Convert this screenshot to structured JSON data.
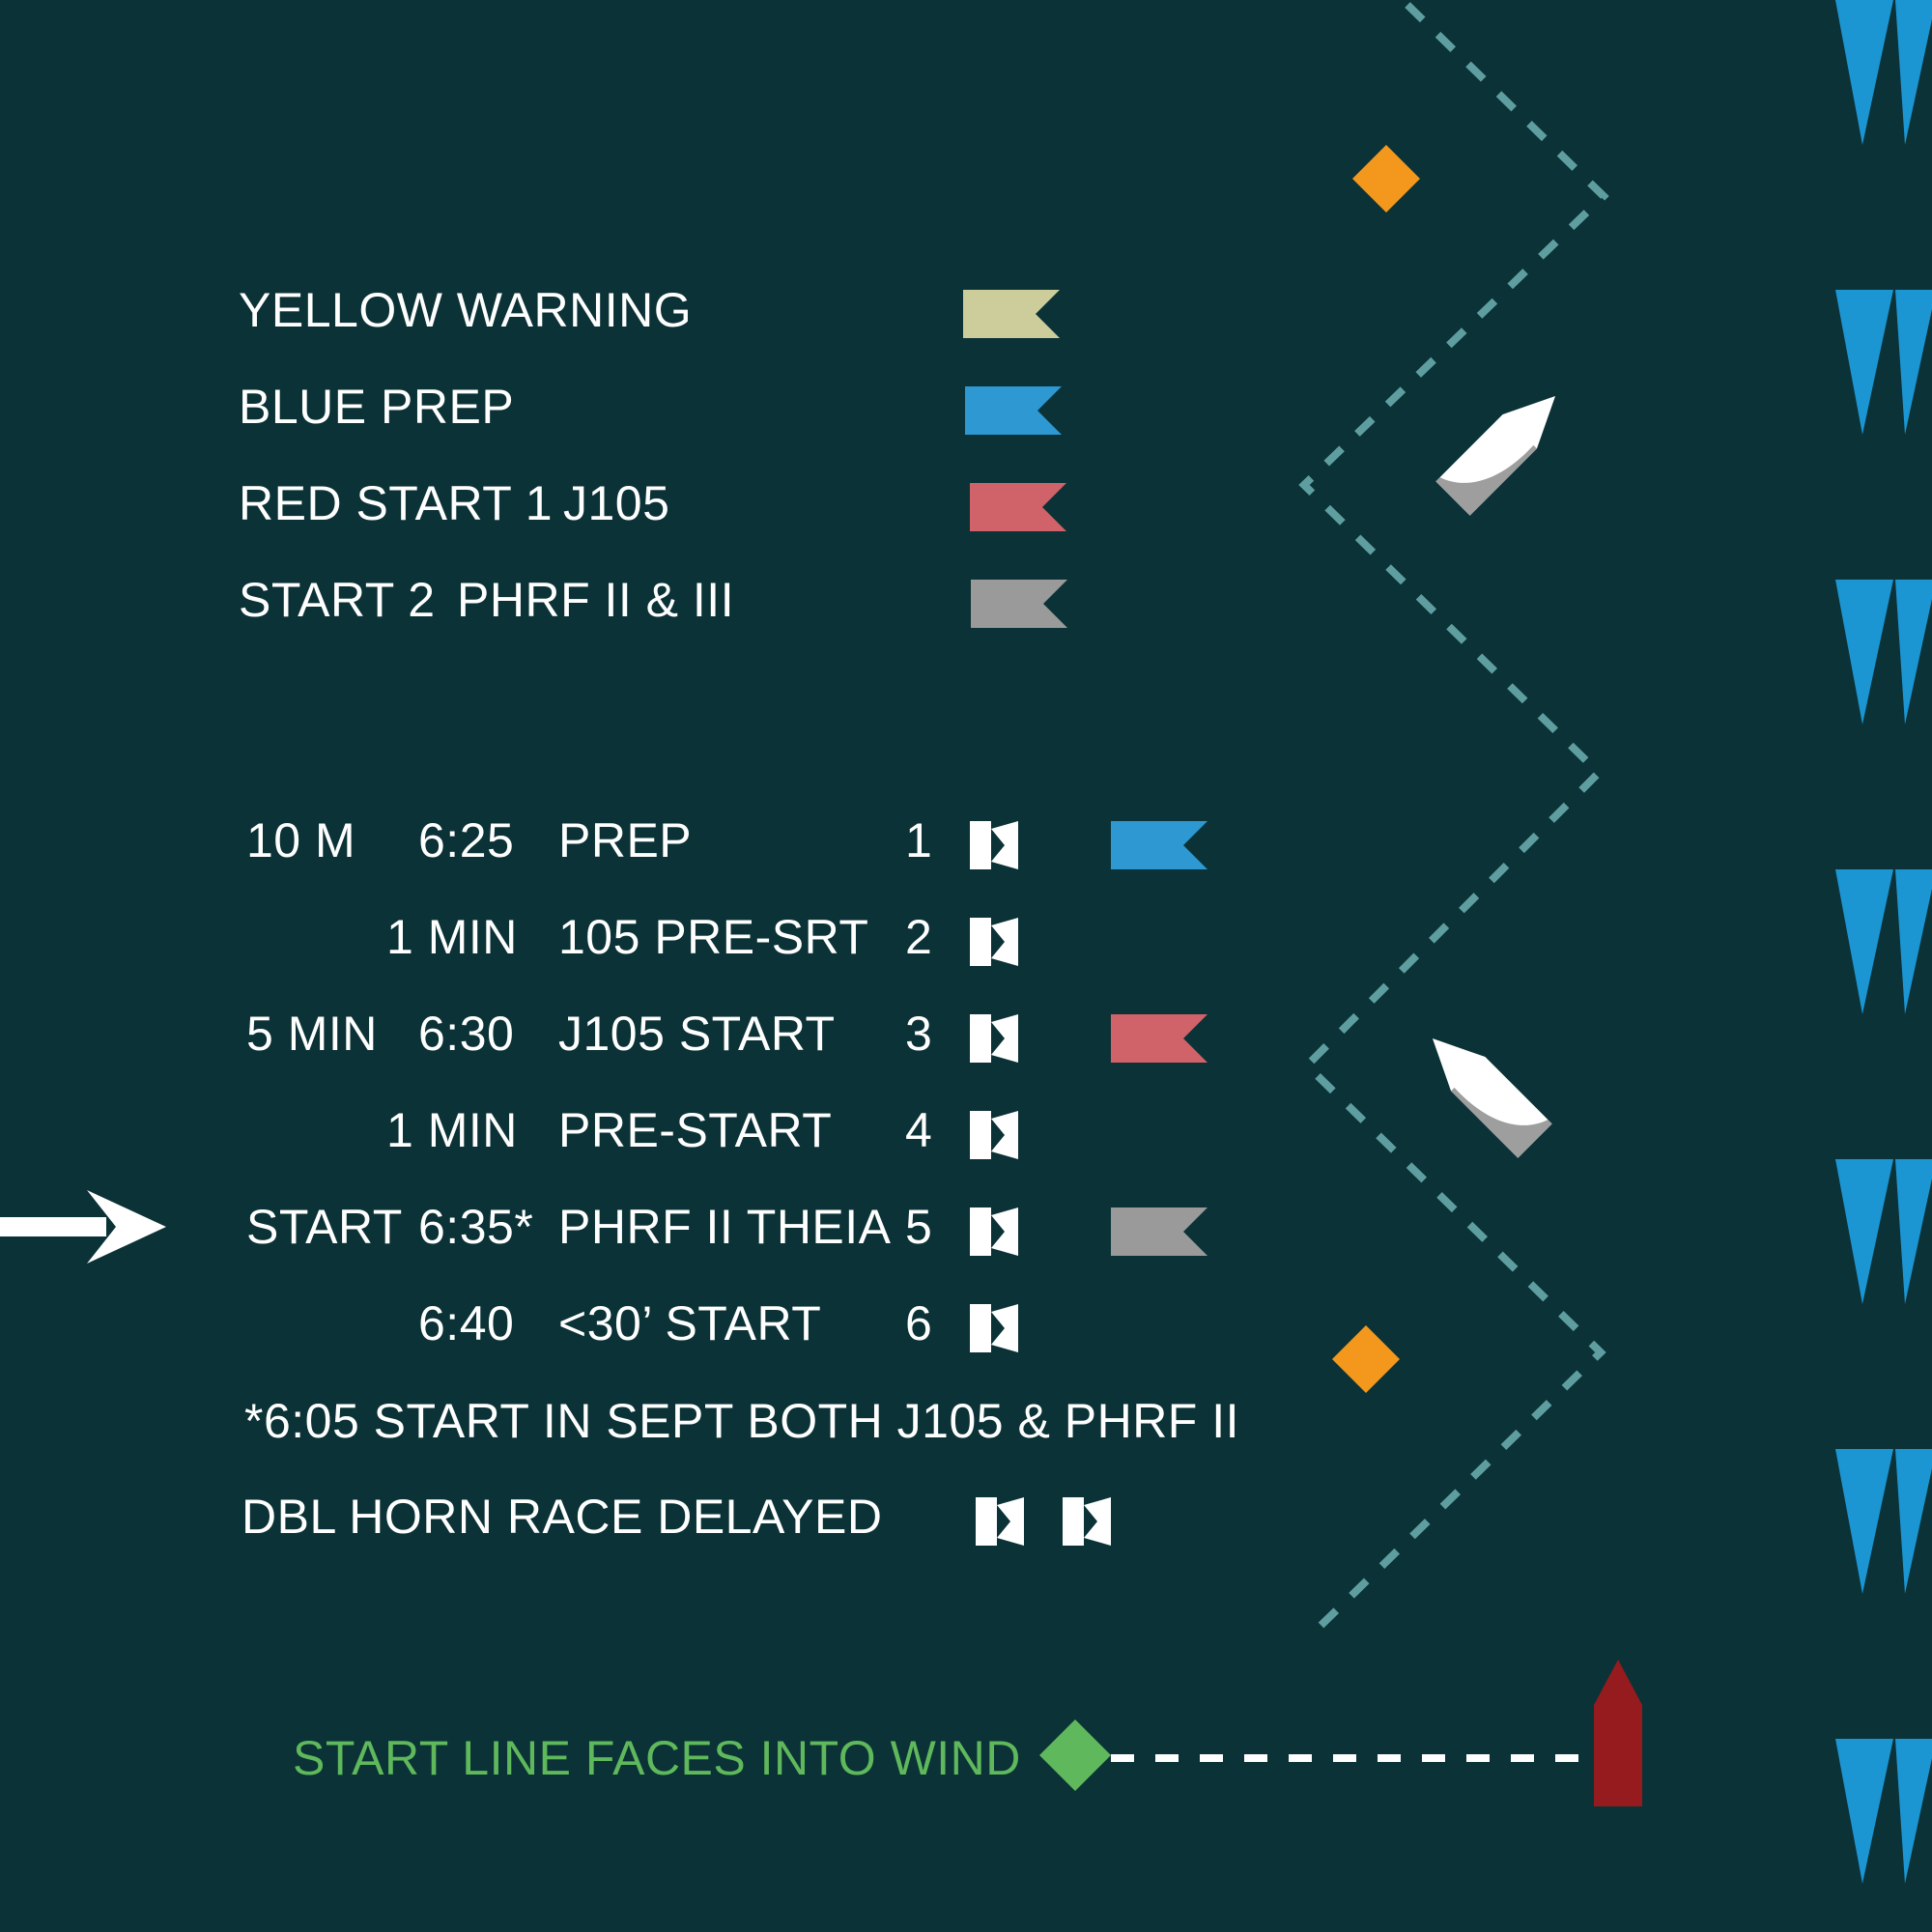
{
  "legend": [
    {
      "label": "YELLOW WARNING",
      "class": "",
      "flag_color": "#cdcc9b"
    },
    {
      "label": "BLUE PREP",
      "class": "",
      "flag_color": "#2d98d1"
    },
    {
      "label": "RED START 1",
      "class": "J105",
      "flag_color": "#d0636a"
    },
    {
      "label": "START 2",
      "class": "PHRF II & III",
      "flag_color": "#9a9a9a"
    }
  ],
  "schedule": [
    {
      "interval": "10 M",
      "time": "6:25",
      "event": "PREP",
      "seq": "1",
      "flag_color": "#2d98d1"
    },
    {
      "interval": "1 MIN",
      "time": "",
      "event": "105 PRE-SRT",
      "seq": "2",
      "flag_color": ""
    },
    {
      "interval": "5 MIN",
      "time": "6:30",
      "event": "J105 START",
      "seq": "3",
      "flag_color": "#d0636a"
    },
    {
      "interval": "1 MIN",
      "time": "",
      "event": "PRE-START",
      "seq": "4",
      "flag_color": ""
    },
    {
      "interval": "START",
      "time": "6:35*",
      "event": "PHRF II THEIA",
      "seq": "5",
      "flag_color": "#9a9a9a",
      "current": true
    },
    {
      "interval": "",
      "time": "6:40",
      "event": "<30’ START",
      "seq": "6",
      "flag_color": ""
    }
  ],
  "footnote": "*6:05 START IN SEPT BOTH J105 & PHRF II",
  "delay_note": "DBL HORN RACE DELAYED",
  "start_line_note": "START LINE FACES INTO WIND",
  "colors": {
    "background": "#0b3236",
    "course_line": "#5f9ea0",
    "mark": "#f3981d",
    "pin_end": "#5fb85b",
    "committee_boat": "#951b1e",
    "wind": "#1c95d3",
    "horn_flag": "#ffffff"
  },
  "icons": [
    "arrow-right-icon",
    "horn-flag-icon",
    "sailboat-icon",
    "wind-icon",
    "mark-icon",
    "pin-end-icon",
    "committee-boat-icon"
  ]
}
